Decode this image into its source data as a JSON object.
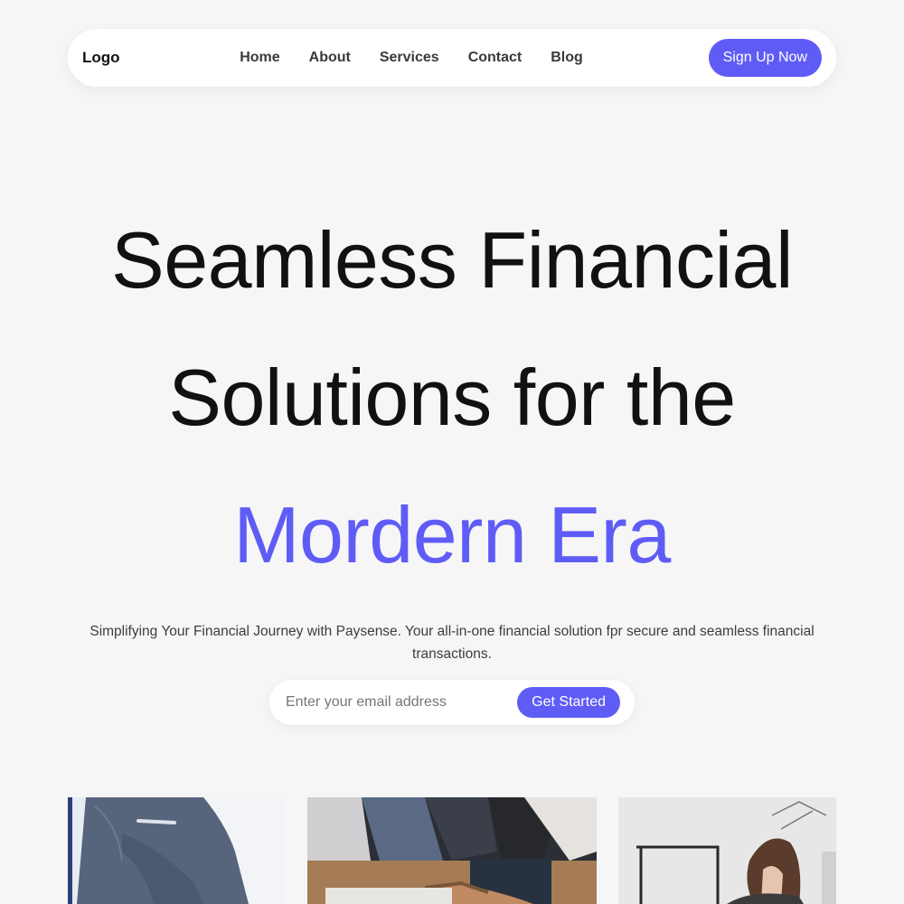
{
  "nav": {
    "logo": "Logo",
    "links": [
      "Home",
      "About",
      "Services",
      "Contact",
      "Blog"
    ],
    "cta_label": "Sign Up Now"
  },
  "hero": {
    "title_line1": "Seamless Financial",
    "title_line2": "Solutions for the",
    "title_accent": "Mordern Era",
    "subtitle": "Simplifying Your Financial Journey with Paysense. Your all-in-one financial solution fpr secure and seamless financial transactions."
  },
  "signup_form": {
    "email_placeholder": "Enter your email address",
    "button_label": "Get Started"
  },
  "colors": {
    "accent": "#5f5cf6",
    "background": "#f6f6f7",
    "text": "#111111"
  }
}
